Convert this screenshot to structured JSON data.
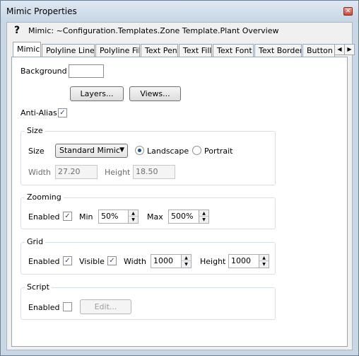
{
  "window": {
    "title": "Mimic Properties",
    "close_glyph": "✕"
  },
  "header": {
    "help_glyph": "?",
    "mimic_path": "Mimic: ~Configuration.Templates.Zone Template.Plant Overview"
  },
  "tabs": [
    {
      "label": "Mimic"
    },
    {
      "label": "Polyline Line"
    },
    {
      "label": "Polyline Fill"
    },
    {
      "label": "Text Pen"
    },
    {
      "label": "Text Fill"
    },
    {
      "label": "Text Font"
    },
    {
      "label": "Text Border"
    },
    {
      "label": "Button F"
    }
  ],
  "tab_scroll": {
    "left": "◀",
    "right": "▶"
  },
  "background": {
    "label": "Background",
    "color": "#ffffff"
  },
  "buttons": {
    "layers": "Layers...",
    "views": "Views..."
  },
  "anti_alias": {
    "label": "Anti-Alias",
    "checked": true
  },
  "size": {
    "group_label": "Size",
    "size_label": "Size",
    "selected": "Standard Mimic",
    "arrow": "▼",
    "landscape": "Landscape",
    "portrait": "Portrait",
    "orientation": "Landscape",
    "width_label": "Width",
    "width": "27.20",
    "height_label": "Height",
    "height": "18.50"
  },
  "zooming": {
    "group_label": "Zooming",
    "enabled_label": "Enabled",
    "enabled": true,
    "min_label": "Min",
    "min": "50%",
    "max_label": "Max",
    "max": "500%"
  },
  "grid": {
    "group_label": "Grid",
    "enabled_label": "Enabled",
    "enabled": true,
    "visible_label": "Visible",
    "visible": true,
    "width_label": "Width",
    "width": "1000",
    "height_label": "Height",
    "height": "1000"
  },
  "script": {
    "group_label": "Script",
    "enabled_label": "Enabled",
    "enabled": false,
    "edit": "Edit..."
  },
  "check_glyph": "✓",
  "spin_glyphs": {
    "up": "▲",
    "down": "▼"
  }
}
